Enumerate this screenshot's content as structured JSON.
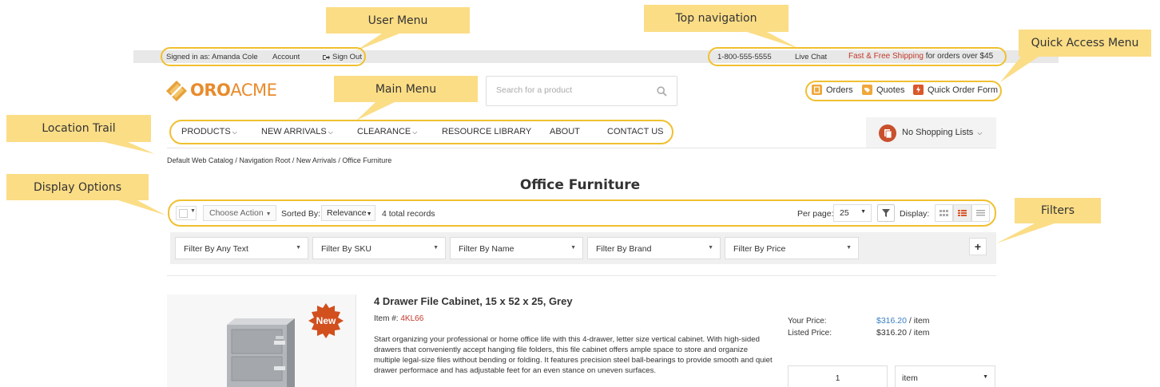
{
  "annotations": {
    "user_menu": "User Menu",
    "top_navigation": "Top navigation",
    "quick_access_menu": "Quick Access Menu",
    "main_menu": "Main Menu",
    "location_trail": "Location Trail",
    "display_options": "Display Options",
    "filters": "Filters"
  },
  "colors": {
    "accent": "#e88b2c",
    "brand_red": "#c0392b",
    "callout_fill": "#fbdd86",
    "callout_outline": "#f0c030",
    "link_blue": "#3a7fc2"
  },
  "user_menu": {
    "signed_in": "Signed in as: Amanda Cole",
    "account": "Account",
    "sign_out": "Sign Out",
    "sign_out_icon": "sign-out-icon"
  },
  "top_nav": {
    "phone": "1-800-555-5555",
    "live_chat": "Live Chat",
    "promo_link": "Fast & Free Shipping",
    "promo_rest": " for orders over $45"
  },
  "logo": {
    "part1": "ORO",
    "part2": "ACME"
  },
  "search": {
    "placeholder": "Search for a product",
    "icon": "search-icon"
  },
  "quick_access": {
    "orders": "Orders",
    "quotes": "Quotes",
    "quick_order_form": "Quick Order Form"
  },
  "main_menu": {
    "items": [
      {
        "label": "PRODUCTS",
        "dropdown": true
      },
      {
        "label": "NEW ARRIVALS",
        "dropdown": true
      },
      {
        "label": "CLEARANCE",
        "dropdown": true
      },
      {
        "label": "RESOURCE LIBRARY",
        "dropdown": false
      },
      {
        "label": "ABOUT",
        "dropdown": false
      },
      {
        "label": "CONTACT US",
        "dropdown": false
      }
    ]
  },
  "shopping_list": {
    "label": "No Shopping Lists",
    "icon": "shopping-list-icon"
  },
  "breadcrumb": "Default Web Catalog / Navigation Root / New Arrivals / Office Furniture",
  "page_title": "Office Furniture",
  "toolbar": {
    "choose_action": "Choose Action",
    "sorted_by_label": "Sorted By:",
    "sorted_by_value": "Relevance",
    "total_records": "4 total records",
    "per_page_label": "Per page:",
    "per_page_value": "25",
    "display_label": "Display:"
  },
  "filters": [
    "Filter By Any Text",
    "Filter By SKU",
    "Filter By Name",
    "Filter By Brand",
    "Filter By Price"
  ],
  "product": {
    "badge": "New",
    "name": "4 Drawer File Cabinet, 15 x 52 x 25, Grey",
    "item_label": "Item #:",
    "item_number": "4KL66",
    "description": "Start organizing your professional or home office life with this 4-drawer, letter size vertical cabinet. With high-sided drawers that conveniently accept hanging file folders, this file cabinet offers ample space to store and organize multiple legal-size files without bending or folding. It features precision steel ball-bearings to provide smooth and quiet drawer performace and has adjustable feet for an even stance on uneven surfaces.",
    "your_price_label": "Your Price:",
    "your_price": "$316.20",
    "listed_price_label": "Listed Price:",
    "listed_price": "$316.20",
    "per_item": " / item",
    "quantity": "1",
    "unit": "item"
  }
}
